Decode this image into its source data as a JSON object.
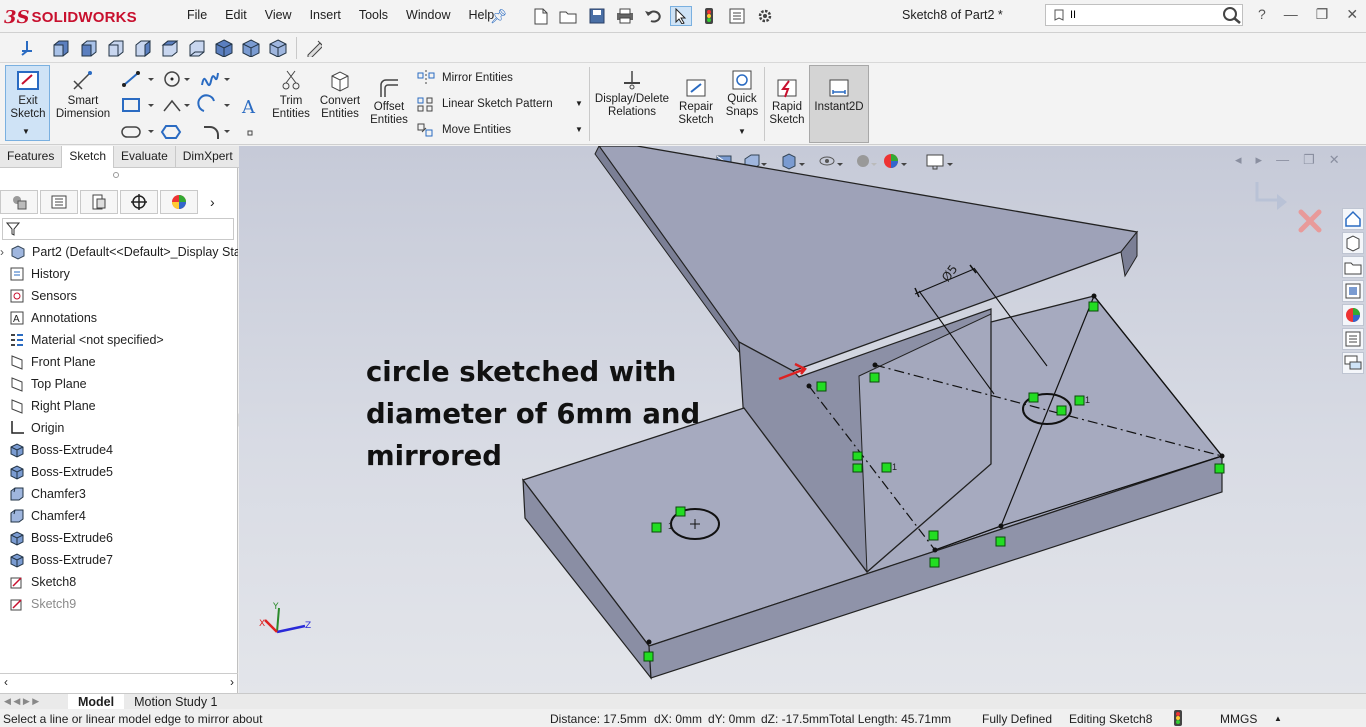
{
  "app": {
    "logo_prefix": "3S",
    "logo_text": "SOLIDWORKS",
    "document_title": "Sketch8 of Part2 *"
  },
  "menu": [
    "File",
    "Edit",
    "View",
    "Insert",
    "Tools",
    "Window",
    "Help"
  ],
  "search": {
    "value": "II"
  },
  "command_manager": {
    "exit_sketch": "Exit\nSketch",
    "smart_dimension": "Smart\nDimension",
    "trim_entities": "Trim\nEntities",
    "convert_entities": "Convert\nEntities",
    "offset_entities": "Offset\nEntities",
    "mirror_entities": "Mirror Entities",
    "linear_sketch_pattern": "Linear Sketch Pattern",
    "move_entities": "Move Entities",
    "display_delete_relations": "Display/Delete\nRelations",
    "repair_sketch": "Repair\nSketch",
    "quick_snaps": "Quick\nSnaps",
    "rapid_sketch": "Rapid\nSketch",
    "instant2d": "Instant2D"
  },
  "tabs": [
    "Features",
    "Sketch",
    "Evaluate",
    "DimXpert"
  ],
  "active_tab": "Sketch",
  "feature_tree": [
    {
      "label": "Part2  (Default<<Default>_Display Stat",
      "icon": "part-icon"
    },
    {
      "label": "History",
      "icon": "history-icon"
    },
    {
      "label": "Sensors",
      "icon": "sensors-icon"
    },
    {
      "label": "Annotations",
      "icon": "annotations-icon"
    },
    {
      "label": "Material <not specified>",
      "icon": "material-icon"
    },
    {
      "label": "Front Plane",
      "icon": "plane-icon"
    },
    {
      "label": "Top Plane",
      "icon": "plane-icon"
    },
    {
      "label": "Right Plane",
      "icon": "plane-icon"
    },
    {
      "label": "Origin",
      "icon": "origin-icon"
    },
    {
      "label": "Boss-Extrude4",
      "icon": "extrude-icon"
    },
    {
      "label": "Boss-Extrude5",
      "icon": "extrude-icon"
    },
    {
      "label": "Chamfer3",
      "icon": "chamfer-icon"
    },
    {
      "label": "Chamfer4",
      "icon": "chamfer-icon"
    },
    {
      "label": "Boss-Extrude6",
      "icon": "extrude-icon"
    },
    {
      "label": "Boss-Extrude7",
      "icon": "extrude-icon"
    },
    {
      "label": "Sketch8",
      "icon": "sketch-icon"
    },
    {
      "label": "Sketch9",
      "icon": "sketch-icon"
    }
  ],
  "bottom_tabs": [
    "Model",
    "Motion Study 1"
  ],
  "status": {
    "prompt": "Select a line or linear model edge to mirror about",
    "distance": "Distance: 17.5mm",
    "dx": "dX: 0mm",
    "dy": "dY: 0mm",
    "dz_total": "dZ: -17.5mmTotal Length: 45.71mm",
    "defined": "Fully Defined",
    "editing": "Editing Sketch8",
    "units": "MMGS"
  },
  "viewport": {
    "annotation": "circle sketched with\ndiameter of 6mm and\nmirrored",
    "dimension_label": "Ø5",
    "relation_label": "1"
  },
  "colors": {
    "accent_red": "#c8102e",
    "sketch_green": "#22dd22",
    "part_face": "#9ea2b8"
  }
}
